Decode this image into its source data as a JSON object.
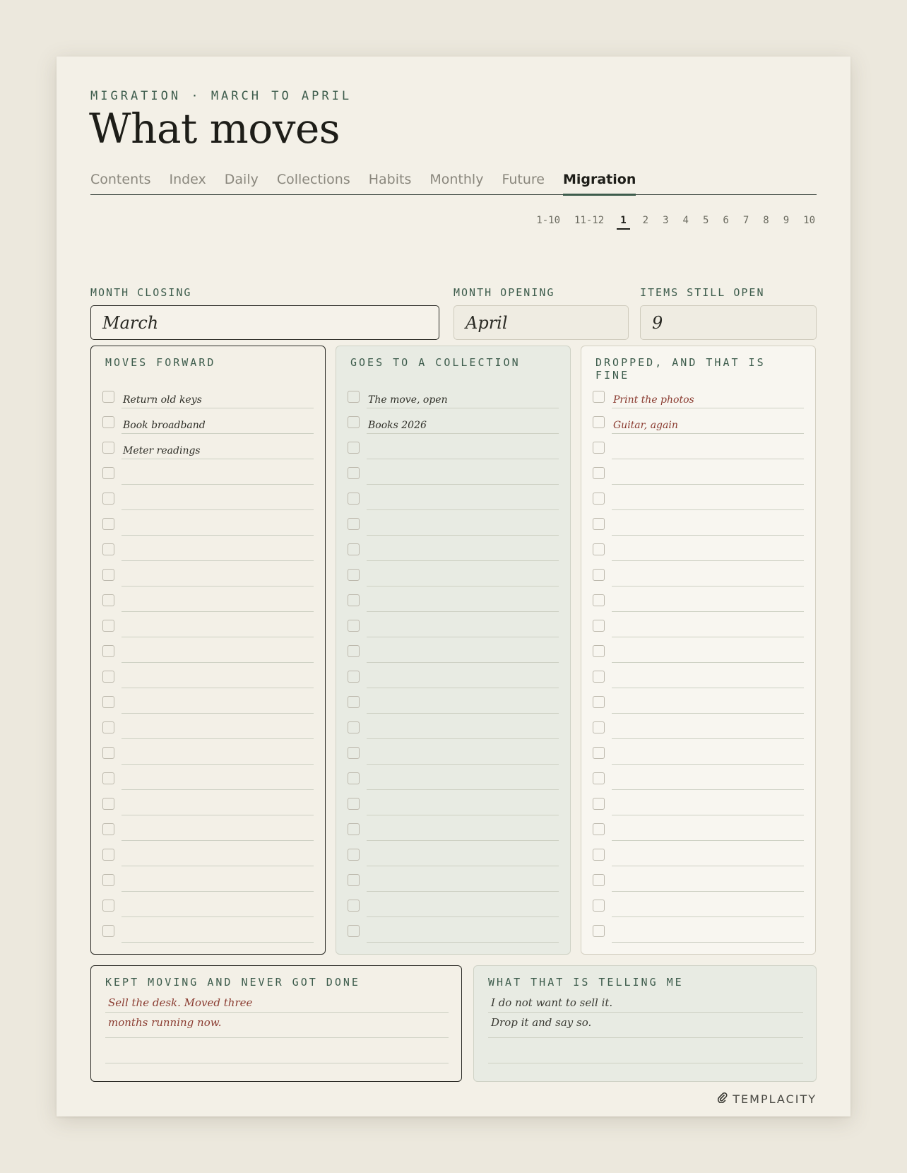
{
  "header": {
    "eyebrow": "MIGRATION · MARCH TO APRIL",
    "title": "What moves"
  },
  "tabs": [
    {
      "label": "Contents"
    },
    {
      "label": "Index"
    },
    {
      "label": "Daily"
    },
    {
      "label": "Collections"
    },
    {
      "label": "Habits"
    },
    {
      "label": "Monthly"
    },
    {
      "label": "Future"
    },
    {
      "label": "Migration",
      "active": true
    }
  ],
  "pager": [
    "1-10",
    "11-12",
    "1",
    "2",
    "3",
    "4",
    "5",
    "6",
    "7",
    "8",
    "9",
    "10"
  ],
  "pager_current": "1",
  "fields": {
    "month_closing": {
      "label": "MONTH CLOSING",
      "value": "March"
    },
    "month_opening": {
      "label": "MONTH OPENING",
      "value": "April"
    },
    "items_still_open": {
      "label": "ITEMS STILL OPEN",
      "value": "9"
    }
  },
  "columns": {
    "moves_forward": {
      "heading": "MOVES FORWARD",
      "items": [
        "Return old keys",
        "Book broadband",
        "Meter readings",
        "",
        "",
        "",
        "",
        "",
        "",
        "",
        "",
        "",
        "",
        "",
        "",
        "",
        "",
        "",
        "",
        "",
        "",
        ""
      ]
    },
    "goes_to_collection": {
      "heading": "GOES TO A COLLECTION",
      "items": [
        "The move, open",
        "Books 2026",
        "",
        "",
        "",
        "",
        "",
        "",
        "",
        "",
        "",
        "",
        "",
        "",
        "",
        "",
        "",
        "",
        "",
        "",
        "",
        ""
      ]
    },
    "dropped": {
      "heading": "DROPPED, AND THAT IS FINE",
      "items": [
        "Print the photos",
        "Guitar, again",
        "",
        "",
        "",
        "",
        "",
        "",
        "",
        "",
        "",
        "",
        "",
        "",
        "",
        "",
        "",
        "",
        "",
        "",
        "",
        ""
      ]
    }
  },
  "kept_moving": {
    "heading": "KEPT MOVING AND NEVER GOT DONE",
    "lines": [
      "Sell the desk. Moved three",
      "months running now.",
      ""
    ]
  },
  "telling_me": {
    "heading": "WHAT THAT IS TELLING ME",
    "lines": [
      "I do not want to sell it.",
      "Drop it and say so.",
      ""
    ]
  },
  "brand": {
    "name": "TEMPLACITY",
    "icon": "paperclip-icon"
  },
  "colors": {
    "accent_green": "#3d5c4c",
    "ink": "#1d1d18",
    "dropped_red": "#8a3b30",
    "paper": "#f3f0e7",
    "background": "#ece8dd"
  }
}
